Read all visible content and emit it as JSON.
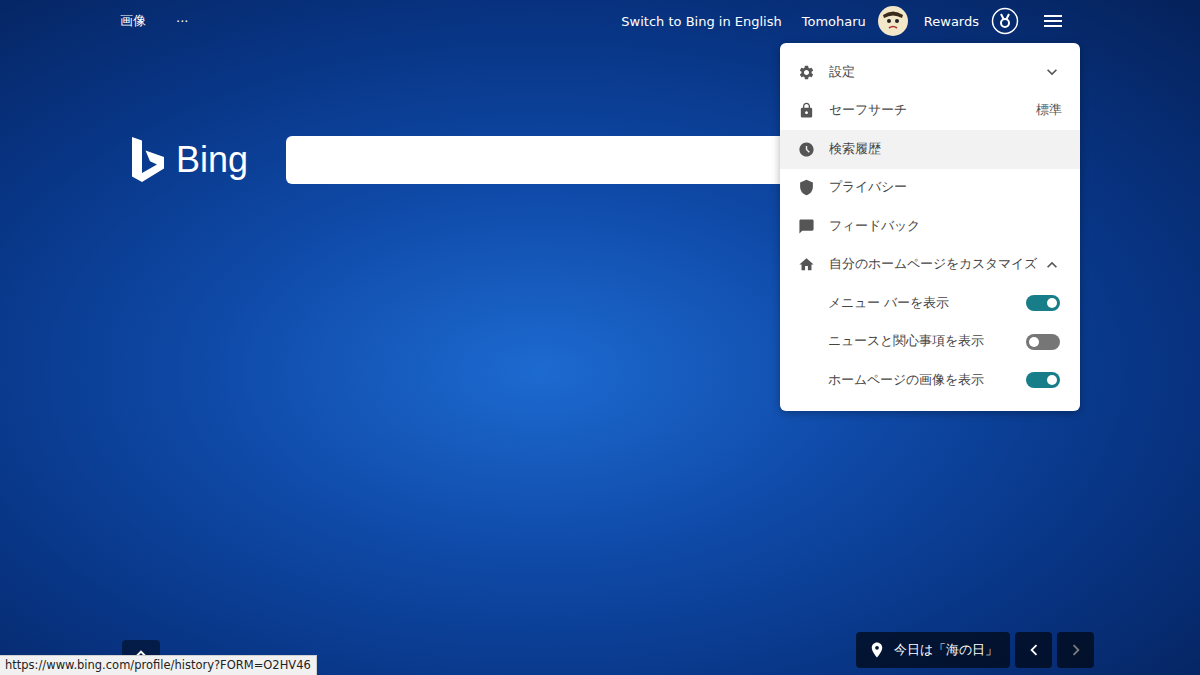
{
  "top_bar": {
    "links": [
      "画像",
      "···"
    ],
    "language_switch": "Switch to Bing in English",
    "user": "Tomoharu",
    "rewards": "Rewards"
  },
  "logo": {
    "text": "Bing"
  },
  "menu": {
    "items": [
      {
        "label": "設定",
        "kind": "expander",
        "expanded": false,
        "selected": false
      },
      {
        "label": "セーフサーチ",
        "kind": "value",
        "value": "標準",
        "selected": false
      },
      {
        "label": "検索履歴",
        "kind": "link",
        "selected": true
      },
      {
        "label": "プライバシー",
        "kind": "link",
        "selected": false
      },
      {
        "label": "フィードバック",
        "kind": "link",
        "selected": false
      },
      {
        "label": "自分のホームページをカスタマイズ",
        "kind": "expander",
        "expanded": true,
        "selected": false
      }
    ],
    "toggles": [
      {
        "label": "メニュー バーを表示",
        "on": true
      },
      {
        "label": "ニュースと関心事項を表示",
        "on": false
      },
      {
        "label": "ホームページの画像を表示",
        "on": true
      }
    ]
  },
  "image_caption": {
    "text": "今日は「海の日」"
  },
  "image_nav": [
    {
      "kind": "previous",
      "disabled": false
    },
    {
      "kind": "next",
      "disabled": true
    }
  ],
  "status_bar": {
    "url": "https://www.bing.com/profile/history?FORM=O2HV46"
  }
}
